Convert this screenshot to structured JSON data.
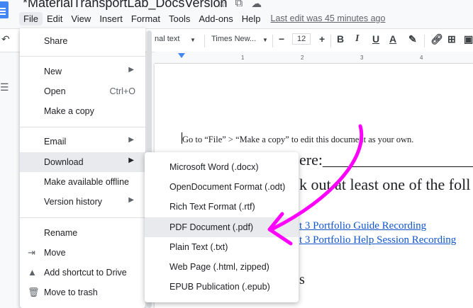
{
  "title": {
    "doc_name": "*MaterialTransportLab_DocsVersion"
  },
  "menubar": {
    "items": [
      "File",
      "Edit",
      "View",
      "Insert",
      "Format",
      "Tools",
      "Add-ons",
      "Help"
    ],
    "last_edit": "Last edit was 45 minutes ago"
  },
  "toolbar": {
    "style": "nal text",
    "font": "Times New...",
    "minus": "−",
    "size": "12",
    "plus": "+",
    "bold": "B",
    "italic": "I",
    "underline": "U",
    "color": "A"
  },
  "ruler": {
    "ticks": [
      "1",
      "2",
      "3",
      "4"
    ]
  },
  "document": {
    "line1": "Go to “File” > “Make a copy” to edit this document as your own.",
    "line2": "ere:____________________",
    "line3": "k out at least one of the foll",
    "link1": "t 3 Portfolio Guide Recording",
    "link2": "t 3 Portfolio Help Session Recording",
    "line4": "s"
  },
  "file_menu": {
    "share": "Share",
    "new": "New",
    "open": "Open",
    "open_shortcut": "Ctrl+O",
    "make_copy": "Make a copy",
    "email": "Email",
    "download": "Download",
    "offline": "Make available offline",
    "version_history": "Version history",
    "rename": "Rename",
    "move": "Move",
    "add_shortcut": "Add shortcut to Drive",
    "trash": "Move to trash"
  },
  "download_menu": {
    "items": [
      "Microsoft Word (.docx)",
      "OpenDocument Format (.odt)",
      "Rich Text Format (.rtf)",
      "PDF Document (.pdf)",
      "Plain Text (.txt)",
      "Web Page (.html, zipped)",
      "EPUB Publication (.epub)"
    ],
    "highlighted_index": 3
  },
  "colors": {
    "annotation": "#ff00ff",
    "link": "#1155cc",
    "highlight": "#e8eaed",
    "accent": "#4285f4"
  }
}
